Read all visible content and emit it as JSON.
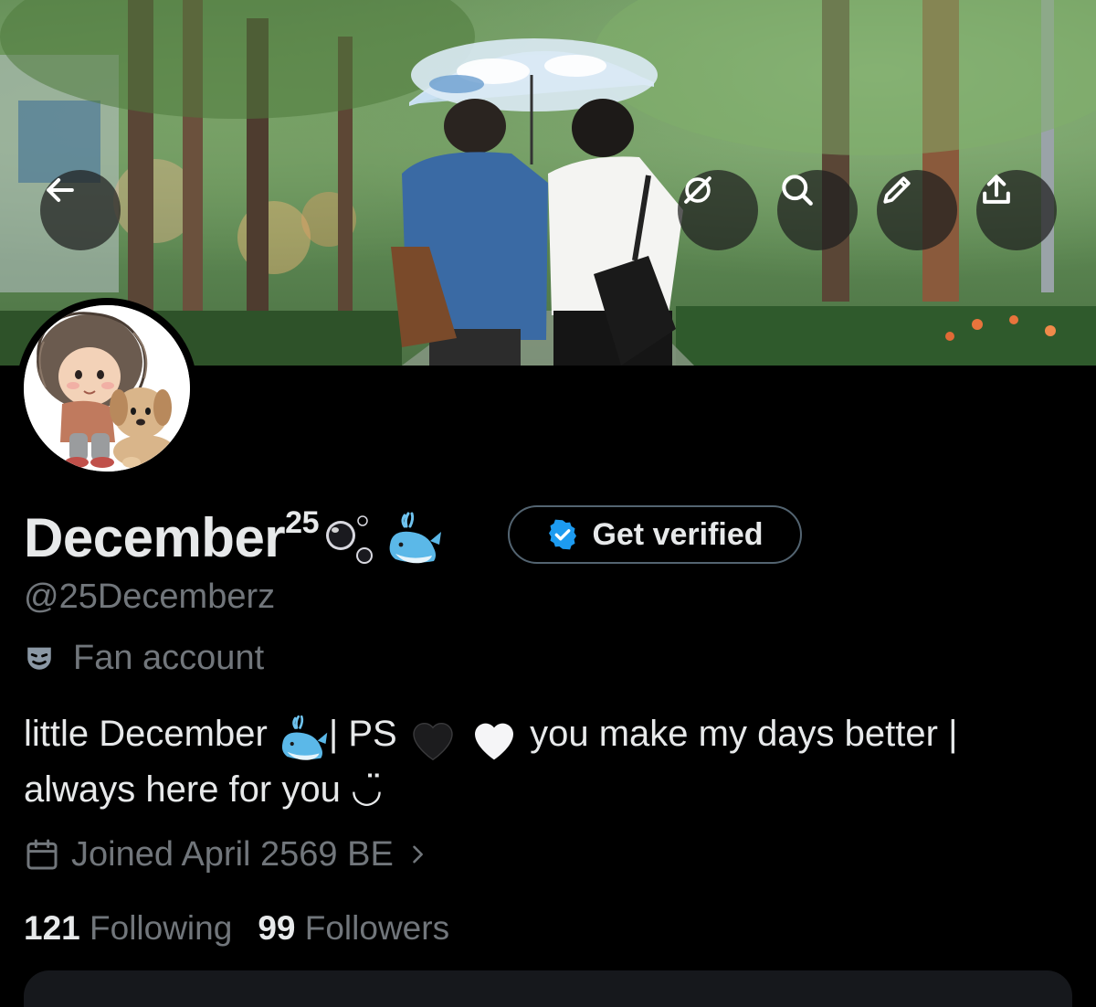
{
  "header": {
    "back_icon": "arrow-left-icon",
    "actions": [
      "grok-icon",
      "search-icon",
      "edit-pencil-icon",
      "share-upload-icon"
    ]
  },
  "profile": {
    "display_name": "December",
    "display_name_superscript": "25",
    "display_name_emojis": [
      "bubbles-emoji",
      "spouting-whale-emoji"
    ],
    "handle": "@25Decemberz",
    "category_icon": "performing-arts-mask-icon",
    "category": "Fan account",
    "bio": {
      "part1": "little December ",
      "part2": "| PS ",
      "part3": " you make my days better | always here for you ",
      "emojis": [
        "spouting-whale-emoji",
        "black-heart-emoji",
        "white-heart-emoji",
        "smile-emoticon"
      ],
      "smile": "◡̈"
    },
    "joined_icon": "calendar-icon",
    "joined": "Joined April 2569 BE",
    "following_count": "121",
    "following_label": "Following",
    "followers_count": "99",
    "followers_label": "Followers"
  },
  "verify_button": {
    "label": "Get verified",
    "icon": "verified-badge-icon"
  },
  "colors": {
    "background": "#000000",
    "text_primary": "#e7e9ea",
    "text_secondary": "#71767b",
    "verified_blue": "#1d9bf0",
    "button_border": "#536471"
  }
}
